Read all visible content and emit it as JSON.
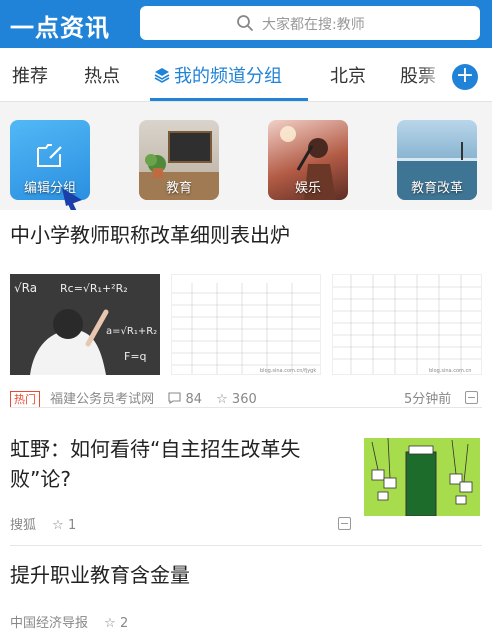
{
  "app": {
    "logo": "一点资讯"
  },
  "search": {
    "placeholder": "大家都在搜:教师"
  },
  "tabs": [
    {
      "label": "推荐"
    },
    {
      "label": "热点"
    },
    {
      "label": "我的频道分组",
      "active": true
    },
    {
      "label": "北京"
    },
    {
      "label": "股票"
    }
  ],
  "add_button": {
    "label": "+"
  },
  "channels": [
    {
      "label": "编辑分组",
      "icon": "edit-folder-icon"
    },
    {
      "label": "教育"
    },
    {
      "label": "娱乐"
    },
    {
      "label": "教育改革"
    }
  ],
  "articles": [
    {
      "title": "中小学教师职称改革细则表出炉",
      "badge": "热门",
      "source": "福建公务员考试网",
      "comments": "84",
      "likes": "360",
      "time": "5分钟前",
      "thumb_texts": [
        "√Ra",
        "Rc=√R₁+²R₂",
        "F=q",
        "a=√R₁+R₂",
        "blog.sina.com.cn/fjygk",
        "blog.sina.com.cn"
      ]
    },
    {
      "title": "虹野：如何看待“自主招生改革失败”论?",
      "source": "搜狐",
      "likes": "1"
    },
    {
      "title": "提升职业教育含金量",
      "source": "中国经济导报",
      "likes": "2"
    }
  ],
  "colors": {
    "brand": "#2183d8",
    "hot": "#e9492f"
  }
}
